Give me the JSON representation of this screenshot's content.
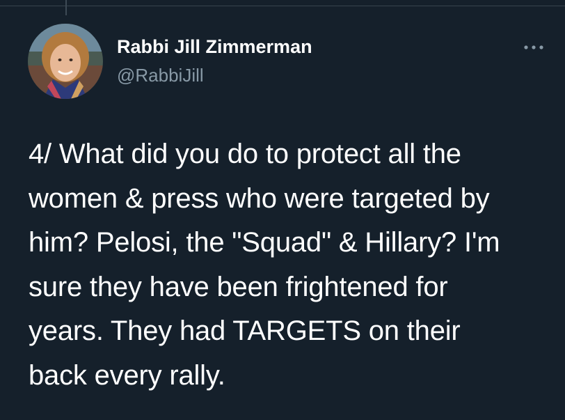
{
  "colors": {
    "background": "#15202b",
    "divider": "#38444d",
    "primary_text": "#ffffff",
    "secondary_text": "#8899a6"
  },
  "author": {
    "display_name": "Rabbi Jill Zimmerman",
    "handle": "@RabbiJill",
    "avatar_icon": "profile-photo"
  },
  "actions": {
    "more_icon": "ellipsis-icon"
  },
  "tweet": {
    "text": "4/ What did you do to protect all the\nwomen & press who were targeted by\nhim? Pelosi, the \"Squad\" & Hillary? I'm\nsure they have been frightened for\nyears. They had TARGETS on their\nback every rally."
  }
}
